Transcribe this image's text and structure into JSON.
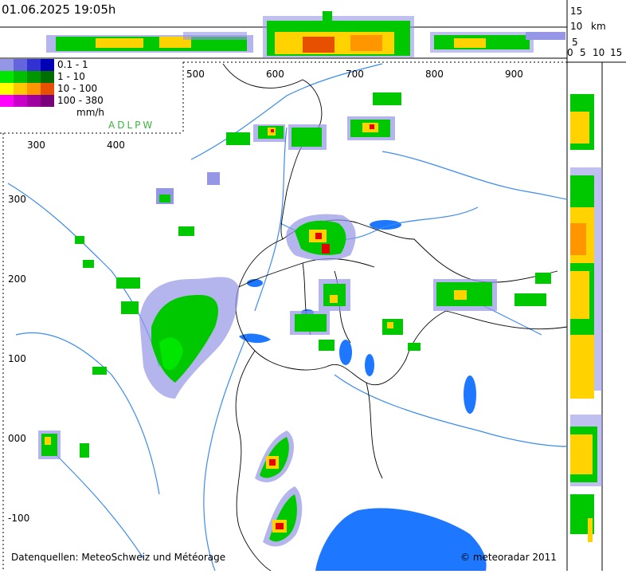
{
  "header": {
    "timestamp": "01.06.2025 19:05h"
  },
  "legend": {
    "rows": [
      {
        "range": "0.1 -    1",
        "colors": [
          "#9696e6",
          "#6464dc",
          "#3232d2",
          "#0000b4"
        ]
      },
      {
        "range": "1 -   10",
        "colors": [
          "#00e600",
          "#00be00",
          "#009600",
          "#006e00"
        ]
      },
      {
        "range": "10 - 100",
        "colors": [
          "#ffff00",
          "#ffc800",
          "#ff9600",
          "#e65000"
        ]
      },
      {
        "range": "100 - 380",
        "colors": [
          "#ff00ff",
          "#c800c8",
          "#a000a0",
          "#780078"
        ]
      }
    ],
    "unit": "mm/h",
    "radars": "ADLPW"
  },
  "map_axes": {
    "x_top": [
      "500",
      "600",
      "700",
      "800",
      "900"
    ],
    "x_left_strip": [
      "300",
      "400"
    ],
    "y_left": [
      "300",
      "200",
      "100",
      "000",
      "-100"
    ]
  },
  "cross_section_axes": {
    "height_top": [
      "15",
      "10",
      "5",
      "km"
    ],
    "height_right": [
      "0",
      "5",
      "10",
      "15"
    ]
  },
  "footer": {
    "sources": "Datenquellen: MeteoSchweiz und Météorage",
    "copyright": "© meteoradar 2011"
  },
  "colors": {
    "water": "#1e78ff",
    "river": "#3c8cf0",
    "border": "#000000",
    "rain_light": "#9696e6",
    "rain_green": "#00c800",
    "rain_yellow": "#ffd200",
    "rain_red": "#e60000"
  }
}
